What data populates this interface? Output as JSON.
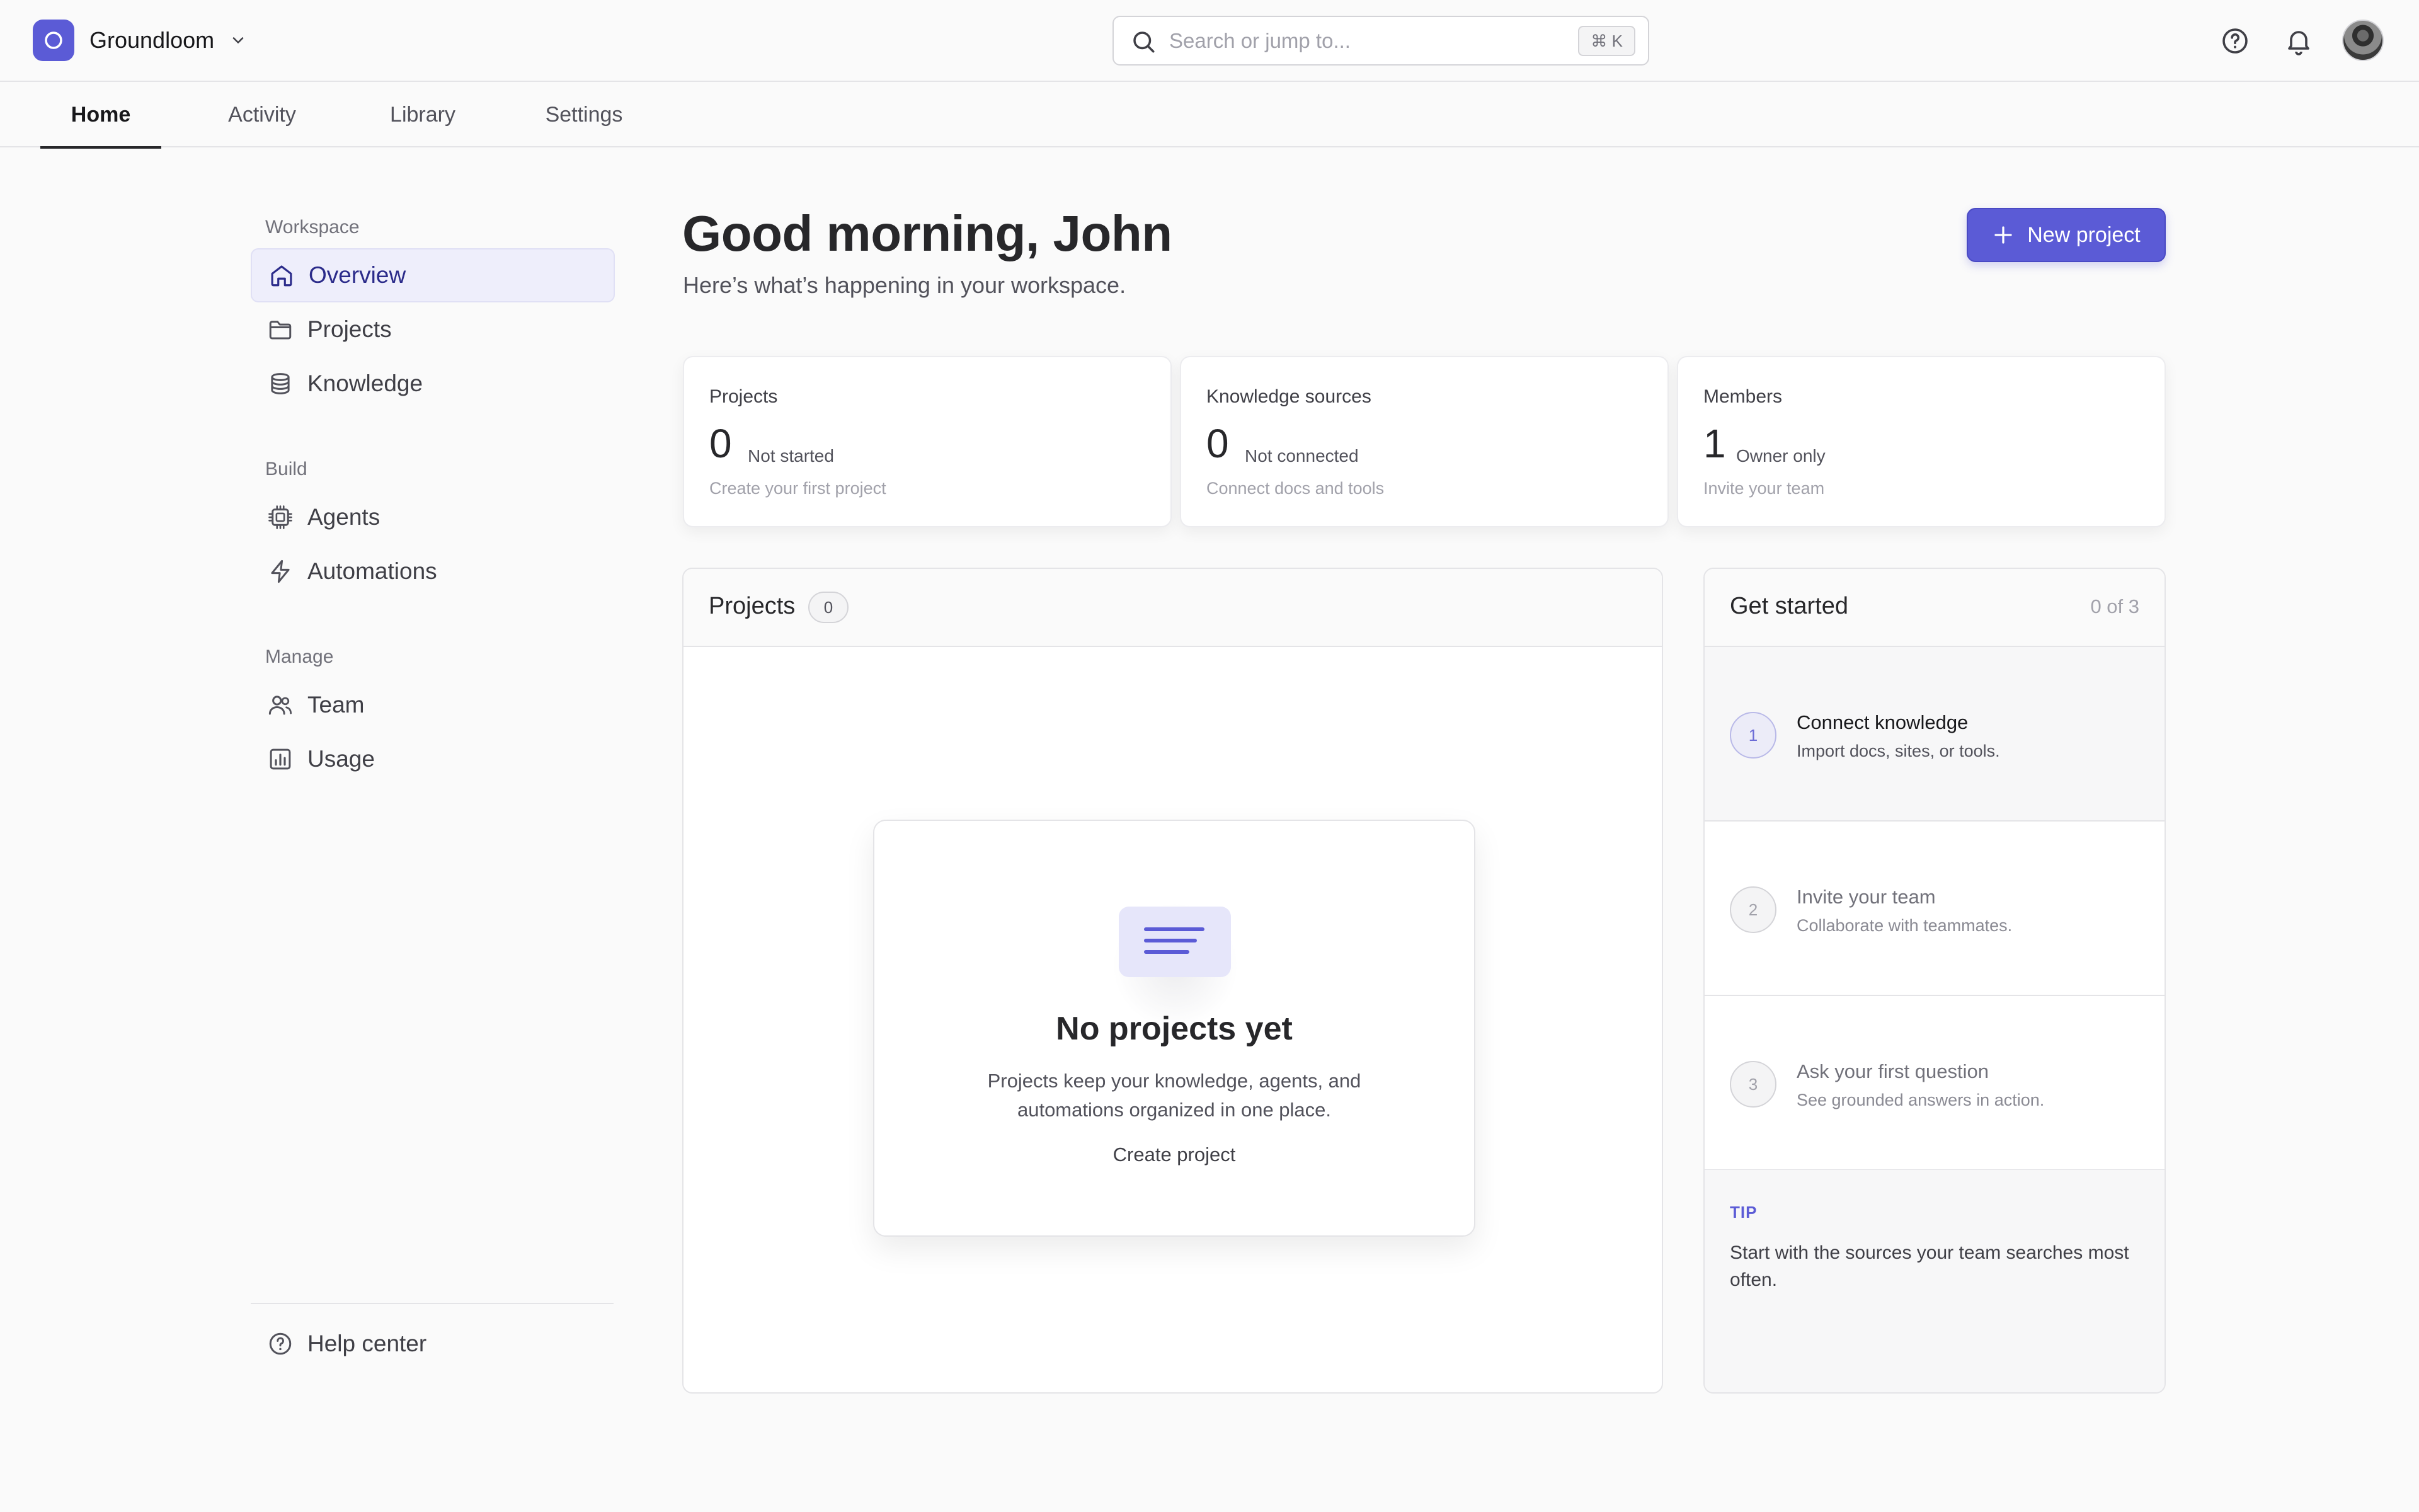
{
  "app": {
    "name": "Groundloom",
    "accent": "#5b5bd6"
  },
  "search": {
    "placeholder": "Search or jump to...",
    "shortcut": "⌘ K"
  },
  "header_icons": [
    "help-circle-icon",
    "bell-icon",
    "user-avatar"
  ],
  "tabs": [
    {
      "label": "Home",
      "active": true
    },
    {
      "label": "Activity",
      "active": false
    },
    {
      "label": "Library",
      "active": false
    },
    {
      "label": "Settings",
      "active": false
    }
  ],
  "sidebar": {
    "sections": [
      {
        "label": "Workspace",
        "items": [
          {
            "label": "Overview",
            "icon": "home-icon",
            "active": true
          },
          {
            "label": "Projects",
            "icon": "folder-icon"
          },
          {
            "label": "Knowledge",
            "icon": "database-icon"
          }
        ]
      },
      {
        "label": "Build",
        "items": [
          {
            "label": "Agents",
            "icon": "chip-icon"
          },
          {
            "label": "Automations",
            "icon": "lightning-icon"
          }
        ]
      },
      {
        "label": "Manage",
        "items": [
          {
            "label": "Team",
            "icon": "users-icon"
          },
          {
            "label": "Usage",
            "icon": "bar-chart-icon"
          }
        ]
      }
    ],
    "help": {
      "label": "Help center",
      "icon": "help-circle-icon"
    }
  },
  "main": {
    "greeting": "Good morning, John",
    "subtitle": "Here’s what’s happening in your workspace.",
    "new_project_label": "New project"
  },
  "stats": [
    {
      "label": "Projects",
      "value": "0",
      "status": "Not started",
      "hint": "Create your first project"
    },
    {
      "label": "Knowledge sources",
      "value": "0",
      "status": "Not connected",
      "hint": "Connect docs and tools"
    },
    {
      "label": "Members",
      "value": "1",
      "status": "Owner only",
      "hint": "Invite your team"
    }
  ],
  "projects_panel": {
    "title": "Projects",
    "count": "0",
    "empty_title": "No projects yet",
    "empty_desc": "Projects keep your knowledge, agents, and automations organized in one place.",
    "empty_action": "Create project"
  },
  "get_started": {
    "title": "Get started",
    "progress": "0 of 3",
    "steps": [
      {
        "num": "1",
        "title": "Connect knowledge",
        "desc": "Import docs, sites, or tools.",
        "current": true
      },
      {
        "num": "2",
        "title": "Invite your team",
        "desc": "Collaborate with teammates."
      },
      {
        "num": "3",
        "title": "Ask your first question",
        "desc": "See grounded answers in action."
      }
    ],
    "tip_label": "TIP",
    "tip_text": "Start with the sources your team searches most often."
  }
}
